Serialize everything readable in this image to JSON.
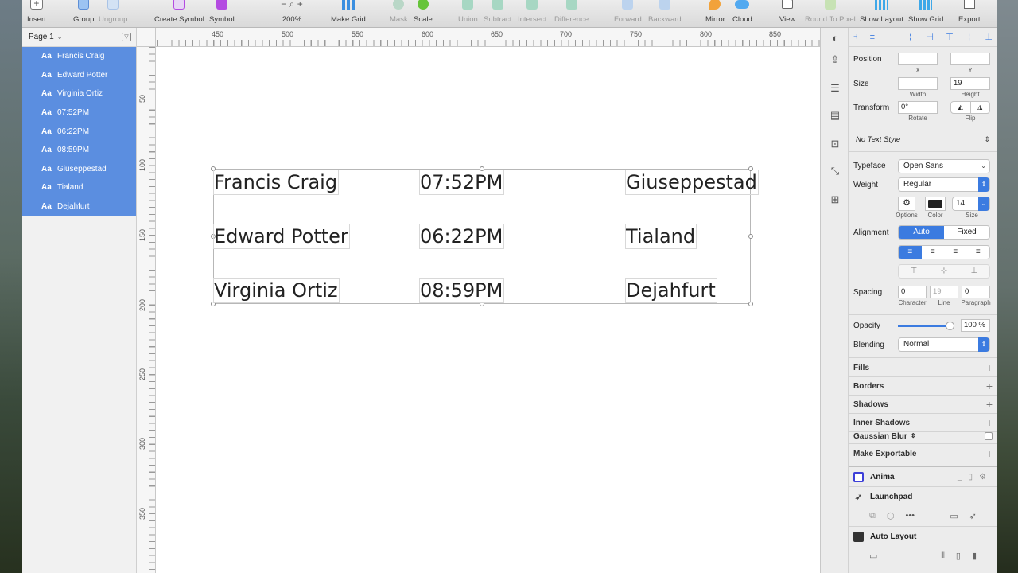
{
  "toolbar": {
    "insert": "Insert",
    "group": "Group",
    "ungroup": "Ungroup",
    "create_symbol": "Create Symbol",
    "symbol": "Symbol",
    "zoom": "200%",
    "make_grid": "Make Grid",
    "mask": "Mask",
    "scale": "Scale",
    "union": "Union",
    "subtract": "Subtract",
    "intersect": "Intersect",
    "difference": "Difference",
    "forward": "Forward",
    "backward": "Backward",
    "mirror": "Mirror",
    "cloud": "Cloud",
    "view": "View",
    "round_to_pixel": "Round To Pixel",
    "show_layout": "Show Layout",
    "show_grid": "Show Grid",
    "export": "Export"
  },
  "layers": {
    "page": "Page 1",
    "items": [
      {
        "icon": "Aa",
        "label": "Francis Craig"
      },
      {
        "icon": "Aa",
        "label": "Edward Potter"
      },
      {
        "icon": "Aa",
        "label": "Virginia Ortiz"
      },
      {
        "icon": "Aa",
        "label": "07:52PM"
      },
      {
        "icon": "Aa",
        "label": "06:22PM"
      },
      {
        "icon": "Aa",
        "label": "08:59PM"
      },
      {
        "icon": "Aa",
        "label": "Giuseppestad"
      },
      {
        "icon": "Aa",
        "label": "Tialand"
      },
      {
        "icon": "Aa",
        "label": "Dejahfurt"
      }
    ]
  },
  "ruler": {
    "top": [
      "450",
      "500",
      "550",
      "600",
      "650",
      "700",
      "750",
      "800",
      "850"
    ],
    "left": [
      "50",
      "100",
      "150",
      "200",
      "250",
      "300",
      "350"
    ]
  },
  "canvas": {
    "texts": {
      "name_1": "Francis Craig",
      "name_2": "Edward Potter",
      "name_3": "Virginia Ortiz",
      "time_1": "07:52PM",
      "time_2": "06:22PM",
      "time_3": "08:59PM",
      "city_1": "Giuseppestad",
      "city_2": "Tialand",
      "city_3": "Dejahfurt"
    }
  },
  "inspector": {
    "position_label": "Position",
    "x_caption": "X",
    "y_caption": "Y",
    "x_value": "",
    "y_value": "",
    "size_label": "Size",
    "width_caption": "Width",
    "height_caption": "Height",
    "width_value": "",
    "height_value": "19",
    "transform_label": "Transform",
    "rotate_value": "0°",
    "rotate_caption": "Rotate",
    "flip_caption": "Flip",
    "text_style": "No Text Style",
    "typeface_label": "Typeface",
    "typeface_value": "Open Sans",
    "weight_label": "Weight",
    "weight_value": "Regular",
    "options_caption": "Options",
    "color_caption": "Color",
    "size_caption": "Size",
    "font_size_value": "14",
    "text_color": "#222222",
    "alignment_label": "Alignment",
    "align_auto": "Auto",
    "align_fixed": "Fixed",
    "spacing_label": "Spacing",
    "char_value": "0",
    "line_value": "19",
    "para_value": "0",
    "char_caption": "Character",
    "line_caption": "Line",
    "para_caption": "Paragraph",
    "opacity_label": "Opacity",
    "opacity_value": "100 %",
    "opacity_level": 1.0,
    "blending_label": "Blending",
    "blending_value": "Normal",
    "sections": {
      "fills": "Fills",
      "borders": "Borders",
      "shadows": "Shadows",
      "inner_shadows": "Inner Shadows",
      "gaussian_blur": "Gaussian Blur",
      "make_exportable": "Make Exportable"
    },
    "plugins": {
      "anima": "Anima",
      "launchpad": "Launchpad",
      "auto_layout": "Auto Layout"
    }
  },
  "colors": {
    "accent": "#3b7be0",
    "selection": "#5b8ee0",
    "symbol_purple": "#b44be1"
  }
}
